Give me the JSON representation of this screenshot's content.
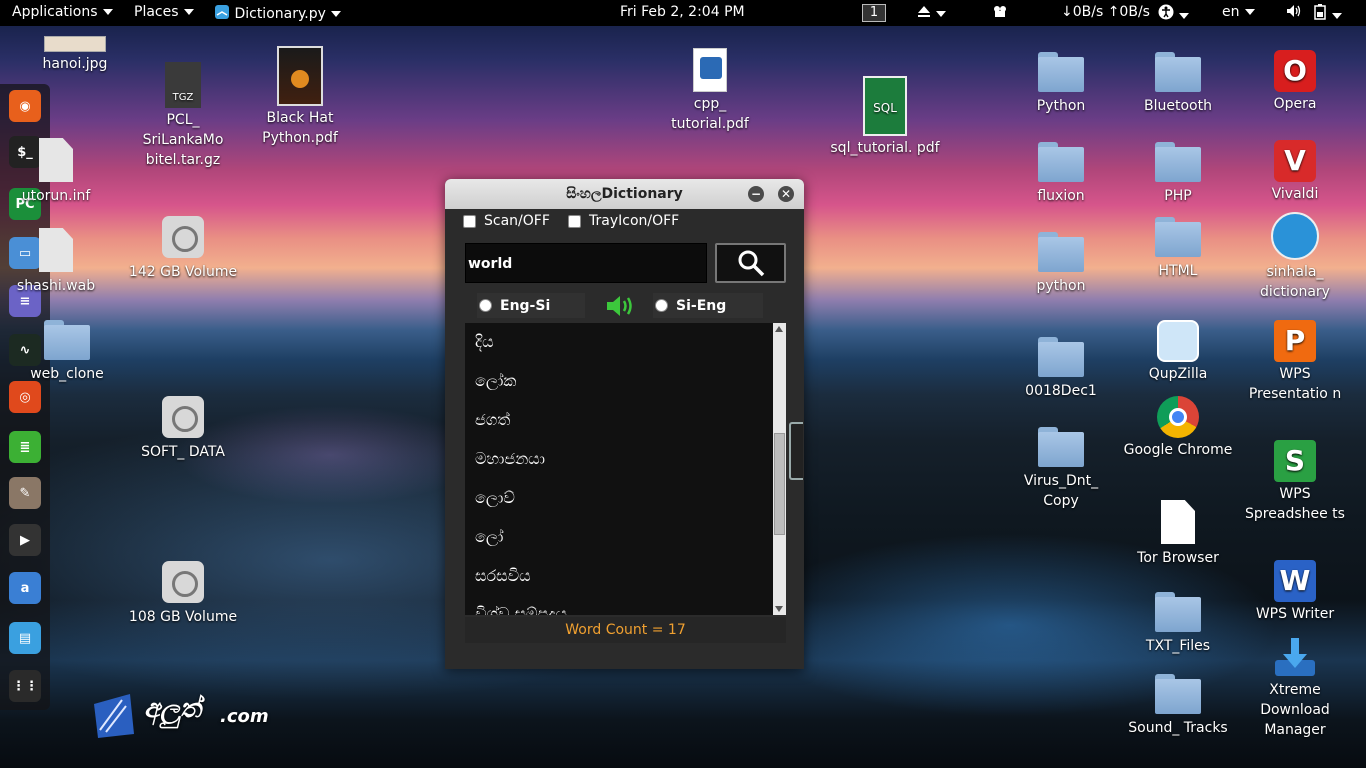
{
  "topbar": {
    "applications": "Applications",
    "places": "Places",
    "app_menu": "Dictionary.py",
    "clock": "Fri Feb  2,  2:04 PM",
    "workspace": "1",
    "network_speed": "↓0B/s ↑0B/s",
    "language": "en"
  },
  "dock": {
    "items": [
      {
        "name": "firefox",
        "color": "#e8601c",
        "glyph": "◉"
      },
      {
        "name": "terminal",
        "color": "#222222",
        "glyph": "$_"
      },
      {
        "name": "pycharm",
        "color": "#1b8f3a",
        "glyph": "PC"
      },
      {
        "name": "files",
        "color": "#4a8fd6",
        "glyph": "▭"
      },
      {
        "name": "text-editor",
        "color": "#6b63c6",
        "glyph": "≡"
      },
      {
        "name": "system-monitor",
        "color": "#1c2a22",
        "glyph": "∿"
      },
      {
        "name": "disc",
        "color": "#e0491c",
        "glyph": "◎"
      },
      {
        "name": "notes",
        "color": "#3cb034",
        "glyph": "≣"
      },
      {
        "name": "gimp",
        "color": "#8a7766",
        "glyph": "✎"
      },
      {
        "name": "video",
        "color": "#333333",
        "glyph": "▶"
      },
      {
        "name": "amazon",
        "color": "#3a7fd4",
        "glyph": "a"
      },
      {
        "name": "dictionary",
        "color": "#3aa0e0",
        "glyph": "▤"
      },
      {
        "name": "app-grid",
        "color": "#2a2a2a",
        "glyph": "⋮⋮"
      }
    ]
  },
  "desktop": {
    "left_icons": [
      {
        "label": "hanoi.jpg",
        "type": "image"
      },
      {
        "label": "PCL_ SriLankaMo bitel.tar.gz",
        "type": "archive"
      },
      {
        "label": "Black Hat Python.pdf",
        "type": "book"
      },
      {
        "label": "utorun.inf",
        "type": "doc"
      },
      {
        "label": "142 GB Volume",
        "type": "drive"
      },
      {
        "label": "shashi.wab",
        "type": "doc"
      },
      {
        "label": "web_clone",
        "type": "folder"
      },
      {
        "label": "SOFT_ DATA",
        "type": "drive"
      },
      {
        "label": "108 GB Volume",
        "type": "drive"
      },
      {
        "label": "cpp_ tutorial.pdf",
        "type": "pdf"
      },
      {
        "label": "sql_tutorial. pdf",
        "type": "pdf"
      }
    ],
    "right_icons": [
      {
        "label": "Python",
        "type": "folder"
      },
      {
        "label": "Bluetooth",
        "type": "folder"
      },
      {
        "label": "Opera",
        "type": "app"
      },
      {
        "label": "fluxion",
        "type": "folder"
      },
      {
        "label": "PHP",
        "type": "folder"
      },
      {
        "label": "Vivaldi",
        "type": "app"
      },
      {
        "label": "python",
        "type": "folder"
      },
      {
        "label": "HTML",
        "type": "folder"
      },
      {
        "label": "sinhala_ dictionary",
        "type": "app"
      },
      {
        "label": "0018Dec1",
        "type": "folder"
      },
      {
        "label": "QupZilla",
        "type": "app"
      },
      {
        "label": "WPS Presentatio n",
        "type": "app"
      },
      {
        "label": "Google Chrome",
        "type": "app"
      },
      {
        "label": "Virus_Dnt_ Copy",
        "type": "folder"
      },
      {
        "label": "WPS Spreadshee ts",
        "type": "app"
      },
      {
        "label": "Tor Browser",
        "type": "doc"
      },
      {
        "label": "TXT_Files",
        "type": "folder"
      },
      {
        "label": "WPS Writer",
        "type": "app"
      },
      {
        "label": "Sound_ Tracks",
        "type": "folder"
      },
      {
        "label": "Xtreme Download Manager",
        "type": "app"
      }
    ]
  },
  "window": {
    "title": "සිංහලDictionary",
    "scan_label": "Scan/OFF",
    "tray_label": "TrayIcon/OFF",
    "search_value": "world",
    "mode_eng_si": "Eng-Si",
    "mode_si_eng": "Si-Eng",
    "results": [
      "දිය",
      "ලෝක",
      "ජගත්",
      "මහාජනයා",
      "ලොව්",
      "ලෝ",
      "සරසවිය",
      "විශ්ව සම්ප්‍රදාය"
    ],
    "word_count": "Word Count = 17"
  },
  "logo": {
    "text": ".com",
    "script": "අලුත්"
  },
  "colors": {
    "accent_orange": "#f0a030",
    "speaker_green": "#3cc83c"
  }
}
